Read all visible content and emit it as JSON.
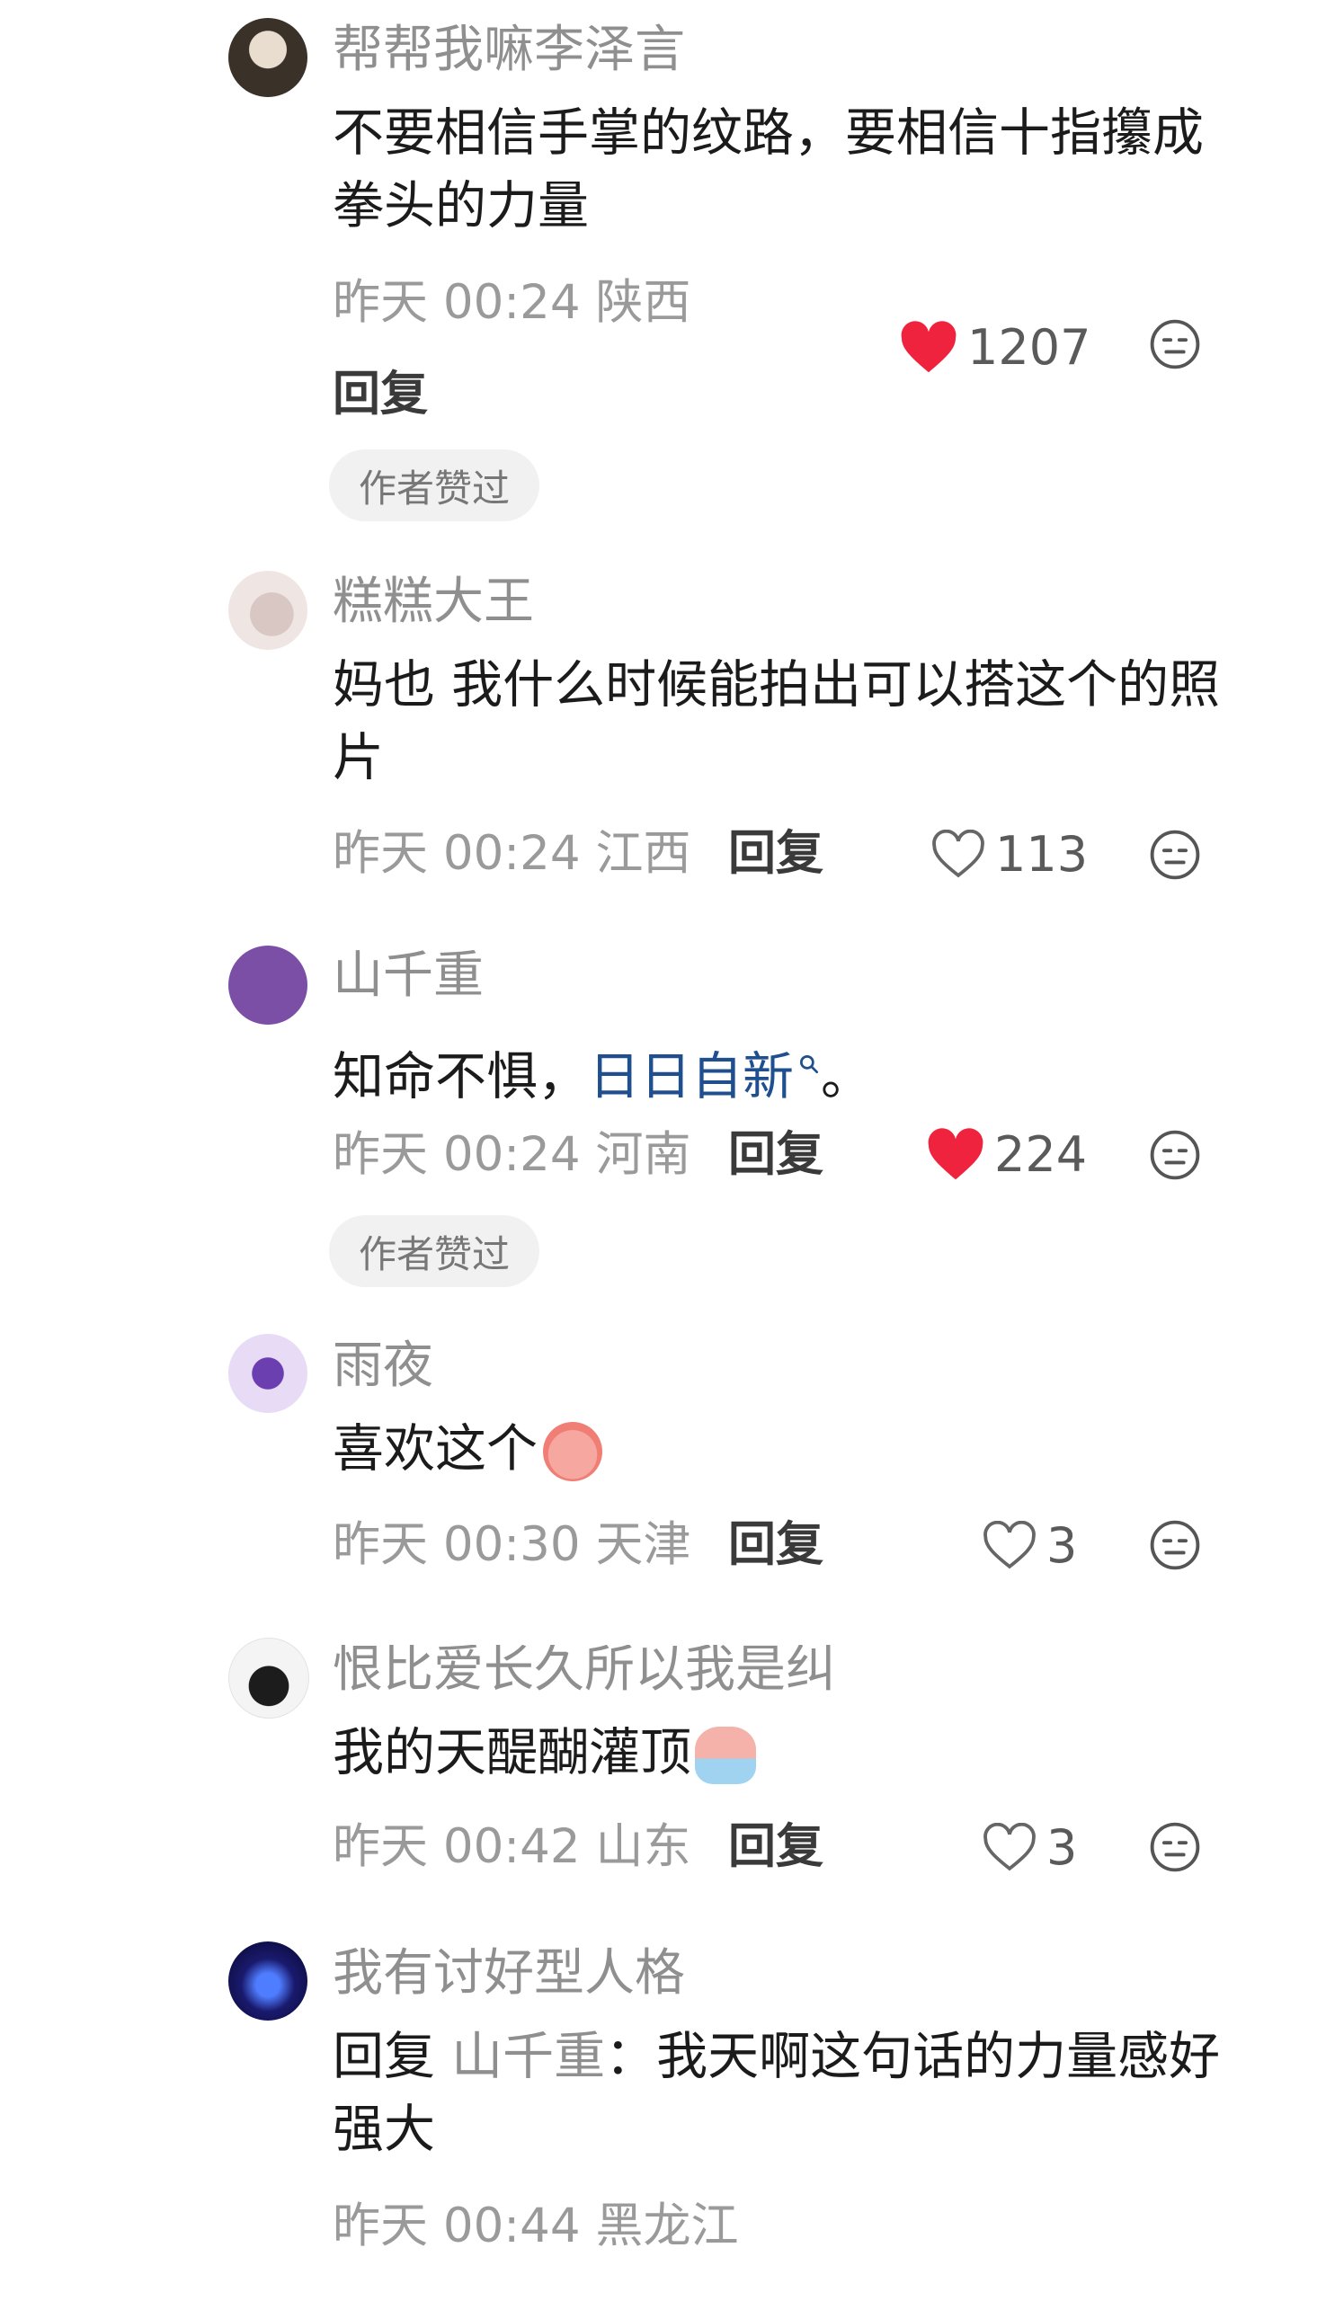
{
  "comments": [
    {
      "name": "帮帮我嘛李泽言",
      "content": "不要相信手掌的纹路，要相信十指攥成拳头的力量",
      "time": "昨天 00:24",
      "location": "陕西",
      "reply": "回复",
      "likes": "1207",
      "liked": true,
      "badge": "作者赞过"
    },
    {
      "name": "糕糕大王",
      "content": "妈也 我什么时候能拍出可以搭这个的照片",
      "time": "昨天 00:24",
      "location": "江西",
      "reply": "回复",
      "likes": "113",
      "liked": false
    },
    {
      "name": "山千重",
      "content_prefix": "知命不惧，",
      "content_link": "日日自新",
      "content_suffix": "。",
      "time": "昨天 00:24",
      "location": "河南",
      "reply": "回复",
      "likes": "224",
      "liked": true,
      "badge": "作者赞过"
    },
    {
      "name": "雨夜",
      "content": "喜欢这个",
      "time": "昨天 00:30",
      "location": "天津",
      "reply": "回复",
      "likes": "3",
      "liked": false
    },
    {
      "name": "恨比爱长久所以我是纠",
      "content": "我的天醍醐灌顶",
      "time": "昨天 00:42",
      "location": "山东",
      "reply": "回复",
      "likes": "3",
      "liked": false
    },
    {
      "name": "我有讨好型人格",
      "reply_prefix": "回复",
      "reply_to": "山千重",
      "content": "：我天啊这句话的力量感好强大",
      "time": "昨天 00:44",
      "location": "黑龙江"
    }
  ],
  "colors": {
    "like_red": "#f0233f",
    "link_blue": "#1f4f8f",
    "meta_grey": "#9a9a9a"
  },
  "icons": [
    "heart-filled-icon",
    "heart-outline-icon",
    "meh-face-icon",
    "search-icon"
  ]
}
